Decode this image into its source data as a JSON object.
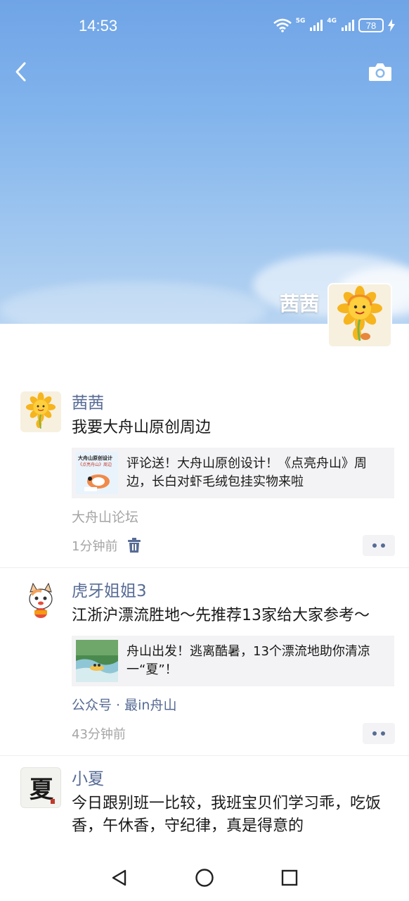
{
  "status_bar": {
    "time": "14:53",
    "network_1": "5G",
    "network_2": "4G",
    "battery": "78"
  },
  "header": {
    "back_icon": "chevron-left-icon",
    "camera_icon": "camera-icon",
    "owner_name": "茜茜"
  },
  "posts": [
    {
      "author": "茜茜",
      "content": "我要大舟山原创周边",
      "share_text": "评论送！大舟山原创设计！《点亮舟山》周边，长白对虾毛绒包挂实物来啦",
      "thumb_text": "大舟山原创设计《点亮舟山》周边",
      "source": "大舟山论坛",
      "time_ago": "1分钟前",
      "has_delete": true
    },
    {
      "author": "虎牙姐姐3",
      "content": "江浙沪漂流胜地～先推荐13家给大家参考～",
      "share_text": "舟山出发！逃离酷暑，13个漂流地助你清凉一“夏”！",
      "source": "公众号 · 最in舟山",
      "time_ago": "43分钟前"
    },
    {
      "author": "小夏",
      "content": "今日跟别班一比较，我班宝贝们学习乖，吃饭香，午休香，守纪律，真是得意的"
    }
  ],
  "avatar_glyphs": {
    "xiaxia": "夏"
  },
  "colors": {
    "link": "#576b95",
    "meta": "#a5a5a5",
    "card_bg": "#f3f3f5"
  }
}
